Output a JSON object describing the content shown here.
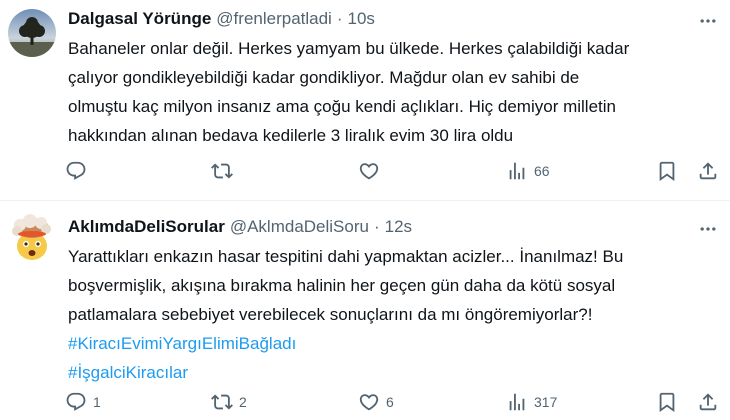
{
  "tweets": [
    {
      "name": "Dalgasal Yörünge",
      "handle": "@frenlerpatladi",
      "separator": "·",
      "time": "10s",
      "lines": [
        "Bahaneler onlar değil. Herkes yamyam bu ülkede. Herkes çalabildiği kadar",
        "çalıyor gondikleyebildiği kadar gondikliyor. Mağdur olan ev sahibi de",
        "olmuştu kaç milyon insanız ama çoğu kendi açlıkları. Hiç demiyor milletin",
        "hakkından alınan bedava kedilerle 3 liralık evim 30 lira oldu"
      ],
      "hashtags": [],
      "counts": {
        "reply": "",
        "retweet": "",
        "like": "",
        "views": "66"
      },
      "avatar": "tree-at-dusk"
    },
    {
      "name": "AklımdaDeliSorular",
      "handle": "@AklmdaDeliSoru",
      "separator": "·",
      "time": "12s",
      "lines": [
        "Yarattıkları enkazın hasar tespitini dahi yapmaktan acizler... İnanılmaz! Bu",
        "boşvermişlik, akışına bırakma halinin her geçen gün daha da kötü sosyal",
        "patlamalara sebebiyet verebilecek sonuçlarını da mı öngöremiyorlar?!"
      ],
      "hashtags": [
        "#KiracıEvimiYargıElimiBağladı",
        "#İşgalciKiracılar"
      ],
      "counts": {
        "reply": "1",
        "retweet": "2",
        "like": "6",
        "views": "317"
      },
      "avatar": "exploding-head-emoji"
    }
  ],
  "icons": [
    "more-icon",
    "reply-icon",
    "retweet-icon",
    "like-icon",
    "views-icon",
    "bookmark-icon",
    "share-icon"
  ],
  "colors": {
    "text": "#0f1419",
    "secondary": "#536471",
    "link": "#1d9bf0",
    "divider": "#eff3f4"
  }
}
